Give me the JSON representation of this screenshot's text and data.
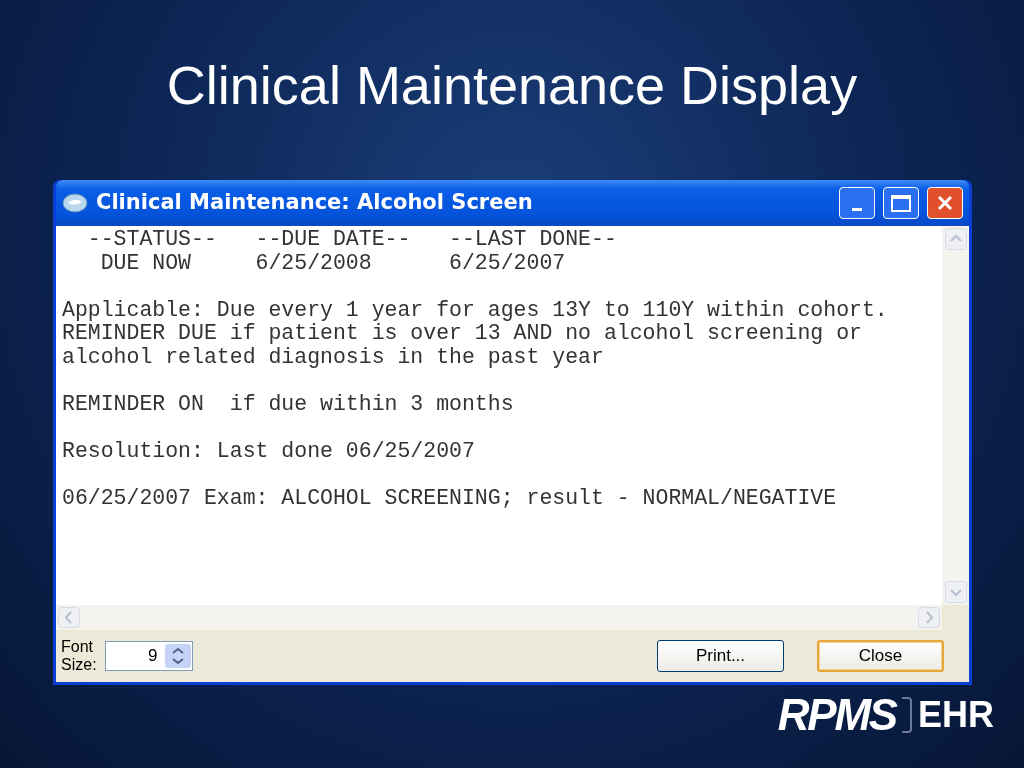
{
  "slide_title": "Clinical Maintenance Display",
  "window": {
    "title": "Clinical Maintenance: Alcohol Screen"
  },
  "report": {
    "paragraphs": [
      [
        "  --STATUS--   --DUE DATE--   --LAST DONE--",
        "   DUE NOW     6/25/2008      6/25/2007"
      ],
      [
        "Applicable: Due every 1 year for ages 13Y to 110Y within cohort.",
        "REMINDER DUE if patient is over 13 AND no alcohol screening or",
        "alcohol related diagnosis in the past year"
      ],
      [
        "REMINDER ON  if due within 3 months"
      ],
      [
        "Resolution: Last done 06/25/2007"
      ],
      [
        "06/25/2007 Exam: ALCOHOL SCREENING; result - NORMAL/NEGATIVE"
      ]
    ]
  },
  "font_size": {
    "label_lines": [
      "Font",
      "Size:"
    ],
    "value": "9"
  },
  "buttons": [
    {
      "label": "Print...",
      "default": false
    },
    {
      "label": "Close",
      "default": true
    }
  ],
  "logo": {
    "main": "RPMS",
    "suffix": "EHR"
  }
}
